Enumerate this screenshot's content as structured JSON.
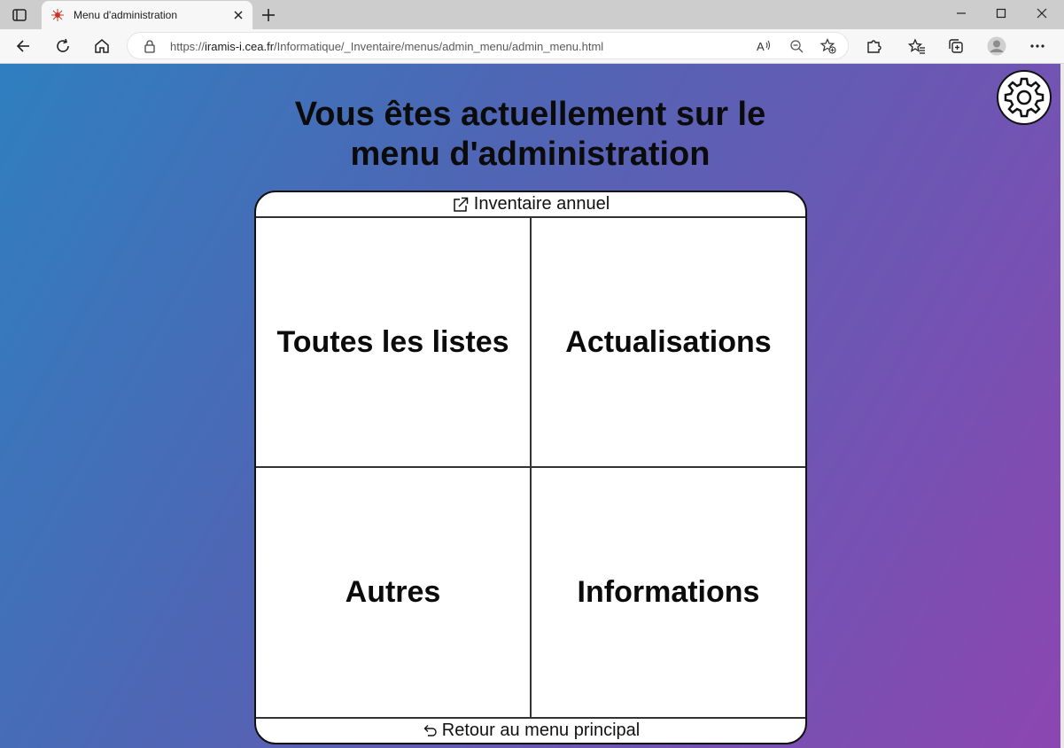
{
  "browser": {
    "tab_title": "Menu d'administration",
    "url_prefix": "https://",
    "url_host": "iramis-i.cea.fr",
    "url_path": "/Informatique/_Inventaire/menus/admin_menu/admin_menu.html"
  },
  "page": {
    "title_line1": "Vous êtes actuellement sur le",
    "title_line2": "menu d'administration",
    "header_link": "Inventaire annuel",
    "cells": {
      "lists": "Toutes les listes",
      "updates": "Actualisations",
      "others": "Autres",
      "info": "Informations"
    },
    "footer_link": "Retour au menu principal"
  },
  "colors": {
    "gradient_start": "#2f7fbf",
    "gradient_end": "#8c46b2"
  }
}
